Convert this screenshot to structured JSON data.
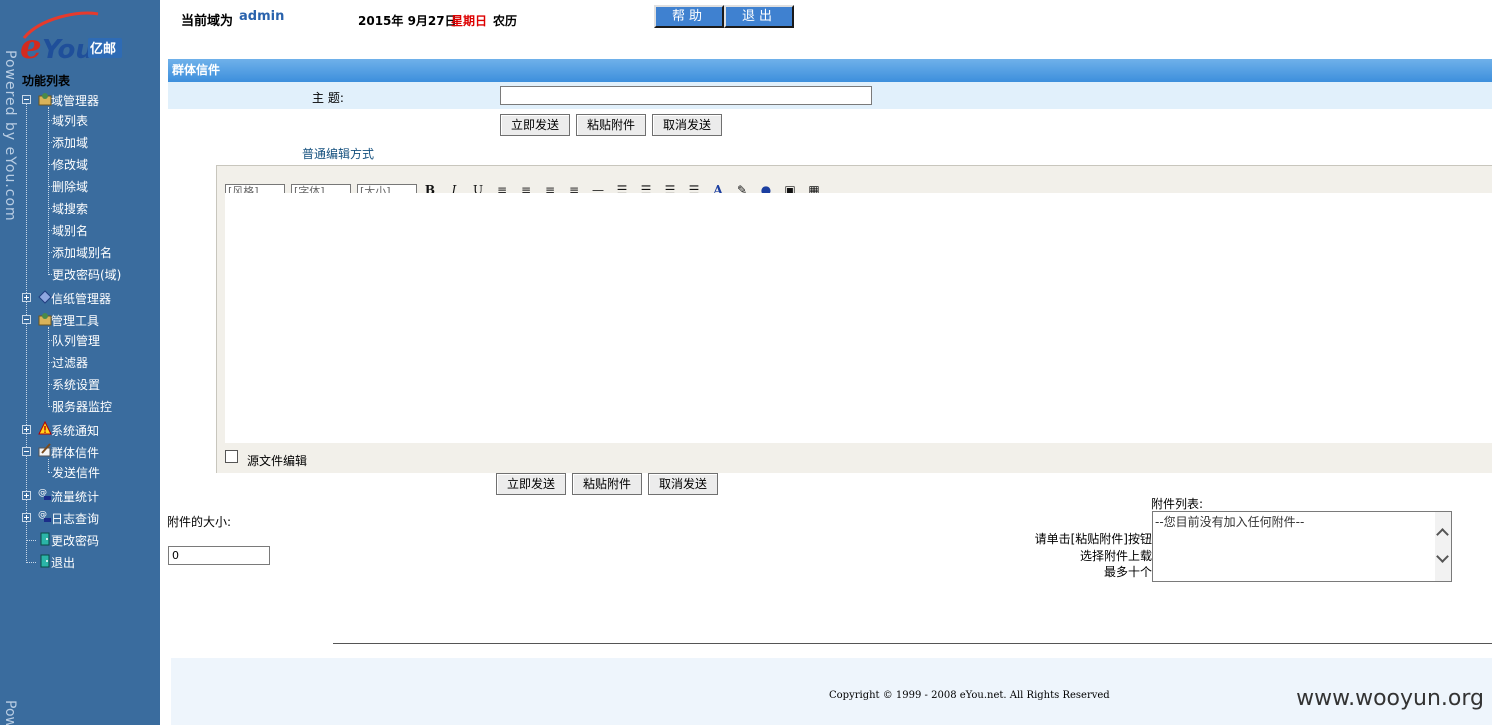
{
  "brand": {
    "logo_text": "eYou亿邮",
    "powered_by": "Powered by eYou.com",
    "powered_by_bottom": "Pow"
  },
  "header": {
    "domain_label": "当前域为",
    "domain_value": "admin",
    "date": "2015年 9月27日",
    "weekday": "星期日",
    "lunar": "农历",
    "help_label": "帮助",
    "logout_label": "退出"
  },
  "sidebar": {
    "title": "功能列表",
    "items": [
      {
        "label": "域管理器",
        "type": "folder",
        "expanded": true
      },
      {
        "label": "域列表"
      },
      {
        "label": "添加域"
      },
      {
        "label": "修改域"
      },
      {
        "label": "删除域"
      },
      {
        "label": "域搜索"
      },
      {
        "label": "域别名"
      },
      {
        "label": "添加域别名"
      },
      {
        "label": "更改密码(域)"
      },
      {
        "label": "信纸管理器",
        "type": "folder",
        "expanded": false
      },
      {
        "label": "管理工具",
        "type": "folder",
        "expanded": true
      },
      {
        "label": "队列管理"
      },
      {
        "label": "过滤器"
      },
      {
        "label": "系统设置"
      },
      {
        "label": "服务器监控"
      },
      {
        "label": "系统通知",
        "type": "folder",
        "expanded": false
      },
      {
        "label": "群体信件",
        "type": "folder",
        "expanded": true
      },
      {
        "label": "发送信件"
      },
      {
        "label": "流量统计",
        "type": "folder",
        "expanded": false
      },
      {
        "label": "日志查询",
        "type": "folder",
        "expanded": false
      },
      {
        "label": "更改密码"
      },
      {
        "label": "退出"
      }
    ]
  },
  "form": {
    "section_title": "群体信件",
    "subject_label": "主 题:",
    "subject_value": "",
    "send_label": "立即发送",
    "attach_label": "粘贴附件",
    "cancel_label": "取消发送",
    "edit_mode_link": "普通编辑方式",
    "toolbar": {
      "style_select": "[风格]",
      "font_select": "[字体]",
      "size_select": "[大小]"
    },
    "source_edit_label": "源文件编辑",
    "source_edit_checked": false,
    "attachment_size_label": "附件的大小:",
    "attachment_size_value": "0",
    "attachment_list_title": "附件列表:",
    "attachment_hint_1": "请单击[粘贴附件]按钮",
    "attachment_hint_2": "选择附件上载",
    "attachment_hint_3": "最多十个",
    "attachment_empty": "--您目前没有加入任何附件--"
  },
  "footer": {
    "copyright": "Copyright © 1999 - 2008 eYou.net. All Rights Reserved",
    "watermark": "www.wooyun.org"
  },
  "colors": {
    "sidebar_bg": "#3a6c9e",
    "section_bar": "#4d9ae2",
    "domain_value": "#2a63ad",
    "weekday": "#dd0000",
    "link": "#14507e"
  }
}
